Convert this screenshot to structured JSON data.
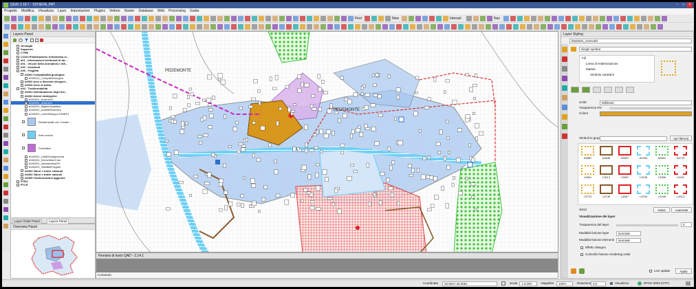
{
  "window": {
    "title": "QGIS 2.18.7 - SCHEDA_PAT"
  },
  "menu": [
    "Progetto",
    "Modifica",
    "Visualizza",
    "Layer",
    "Impostazioni",
    "Plugins",
    "Vettore",
    "Raster",
    "Database",
    "Web",
    "Processing",
    "Guida"
  ],
  "toolbar": {
    "find": "Find",
    "new": "New",
    "interact": "Interact",
    "nav": "Nav"
  },
  "layers_panel": {
    "title": "Layers Panel",
    "items": [
      {
        "label": "Geologia",
        "bold": true,
        "indent": 1
      },
      {
        "label": "Supporto",
        "bold": true,
        "indent": 1
      },
      {
        "label": "CTRN",
        "bold": true,
        "indent": 1
      },
      {
        "label": "C1104 Pianificazione Urbanistica vi...",
        "bold": true,
        "indent": 1
      },
      {
        "label": "a01 - Informazioni territoriali di ba...",
        "bold": true,
        "indent": 1
      },
      {
        "label": "b01 - Vincoli della normativa e dell...",
        "bold": true,
        "indent": 1
      },
      {
        "label": "b02 - Invarianti",
        "bold": true,
        "indent": 1
      },
      {
        "label": "b03 - Fragilità",
        "bold": true,
        "indent": 1
      },
      {
        "label": "b0301 Compatibilità geologica",
        "bold": true,
        "indent": 2
      },
      {
        "label": "b030101_CompatGeologica",
        "bold": false,
        "indent": 3
      },
      {
        "label": "b0302 Aree a dissesto idrogeol...",
        "bold": true,
        "indent": 2
      },
      {
        "label": "b0303 Zone di tutela",
        "bold": true,
        "indent": 2
      },
      {
        "label": "b04 - Trasformabilità",
        "bold": true,
        "indent": 1
      },
      {
        "label": "b0401 Individuazione degli Am...",
        "bold": true,
        "indent": 2
      },
      {
        "label": "b0402 Azioni strategiche",
        "bold": true,
        "indent": 2
      },
      {
        "label": "b040201_AreeUrbC",
        "bold": false,
        "indent": 3
      },
      {
        "label": "b040201_AreeUrbI",
        "bold": false,
        "indent": 3,
        "selected": true
      },
      {
        "label": "b040201_MiglioriQualifica",
        "bold": false,
        "indent": 3
      },
      {
        "label": "b040201_AmbitiRiconvers",
        "bold": false,
        "indent": 3
      },
      {
        "label": "b040201_LineeSviluppo ESNRH",
        "bold": false,
        "indent": 3
      }
    ],
    "legend": [
      {
        "label": "Residenziale con Credito ...",
        "color": "#a8c8f0"
      },
      {
        "label": "Aree servizi",
        "color": "#6dcff6"
      },
      {
        "label": "Produttive",
        "color": "#c06ad8"
      }
    ],
    "items2": [
      {
        "label": "b040201_LimitiSviluppoUrba",
        "indent": 3
      },
      {
        "label": "b040201_ServiziInterCom",
        "indent": 3
      },
      {
        "label": "b040201_InfrastrutturaTE",
        "indent": 3
      },
      {
        "label": "b040201_Viabilit&Progeto",
        "indent": 3
      },
      {
        "label": "b0403 Valori e tutele culturali",
        "bold": true,
        "indent": 2
      },
      {
        "label": "b0404 Valori e tutele naturali",
        "bold": true,
        "indent": 2
      },
      {
        "label": "b0405 Trasformazioni aggiunte",
        "bold": true,
        "indent": 2
      },
      {
        "label": "PTRC",
        "bold": true,
        "indent": 1
      },
      {
        "label": "PTCP",
        "bold": true,
        "indent": 1
      }
    ],
    "tabs": [
      "Layer Order Panel",
      "Layers Panel"
    ]
  },
  "overview": {
    "title": "Overview Panel"
  },
  "map": {
    "labels": [
      "PEDEMONTE",
      "PEDEMONTE"
    ]
  },
  "console": {
    "title": "Finestra di testo QAD - 2.14.1",
    "prompt": "Comando:"
  },
  "styling": {
    "title": "Layer Styling",
    "layer": "b040201_AreeUrbI",
    "renderer": "Single symbol",
    "tree": [
      "Fill",
      "Linea di evidenziazione",
      "Marker",
      "Simbolo carattere"
    ],
    "unita_label": "Unità",
    "unita": "Millimetri",
    "trasp_label": "Trasparenza 0%",
    "colore_label": "Colore",
    "gruppo_label": "Simboli in gruppo",
    "gestore": "Apri libreria",
    "symbols": [
      "A3867",
      "A3836",
      "A3837",
      "A4334",
      "A4631",
      "A4713",
      "L3861",
      "L3013",
      "L2867",
      "L3158",
      "L3286",
      "L3431",
      "L3710",
      "L3746",
      "L3867",
      "L4334",
      "L4346",
      "L4513"
    ],
    "selname": "i4613",
    "salva": "Salva",
    "avanzate": "Avanzate",
    "render_title": "Visualizzazione dei layer",
    "trasp_layer": "Trasparenza del layer",
    "trasp_val": "0",
    "fusione_layer": "Modalità fusione layer",
    "fusione_elem": "Modalità fusione elementi",
    "normale": "Normale",
    "effetti": "Effetto disegno",
    "controllo": "Controllo fusione rendering order",
    "live": "Live update",
    "apply": "Apply"
  },
  "status": {
    "coord_label": "Coordinata",
    "coord": "16.9347.45.3051",
    "scale_label": "Scala",
    "scale": "1:3.000",
    "magn_label": "Magnifier",
    "magn": "100%",
    "rot_label": "Rotazione",
    "rot": "0,0",
    "render_label": "Visualizza",
    "crs": "EPSG:3003 (OTF)"
  },
  "colors": {
    "accent": "#3c5a9a",
    "residential": "#a8c8f0",
    "services": "#6dcff6",
    "productive": "#c06ad8",
    "orange": "#e0a020",
    "red": "#e02020",
    "green": "#3cc23c"
  }
}
